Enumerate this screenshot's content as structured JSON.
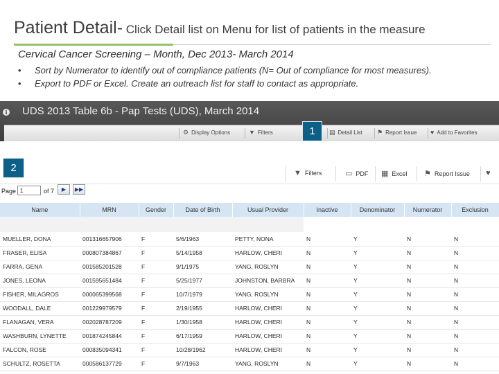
{
  "slide": {
    "title_bold": "Patient Detail-",
    "title_rest": " Click Detail list on Menu for list of patients in the measure",
    "subtitle": "Cervical Cancer Screening – Month,  Dec 2013- March 2014",
    "bullets": [
      "Sort by Numerator  to identify  out of compliance patients (N= Out of compliance for most measures).",
      "Export to PDF or Excel. Create an outreach list for staff to contact as appropriate."
    ]
  },
  "report": {
    "title": "UDS 2013 Table 6b - Pap Tests (UDS), March 2014",
    "toolbar_top": {
      "display_options": "Display Options",
      "filters": "Filters",
      "detail_list": "Detail List",
      "report_issue": "Report Issue",
      "add_to_favorites": "Add to Favorites"
    },
    "badges": {
      "one": "1",
      "two": "2"
    },
    "toolbar_second": {
      "filters": "Filters",
      "pdf": "PDF",
      "excel": "Excel",
      "report_issue": "Report Issue"
    },
    "pager": {
      "label": "Page",
      "current": "1",
      "of": "of 7"
    }
  },
  "table": {
    "columns": [
      "Name",
      "MRN",
      "Gender",
      "Date of Birth",
      "Usual Provider",
      "Inactive",
      "Denominator",
      "Numerator",
      "Exclusion"
    ],
    "rows": [
      [
        "MUELLER, DONA",
        "001316657906",
        "F",
        "5/6/1963",
        "PETTY, NONA",
        "N",
        "Y",
        "N",
        "N"
      ],
      [
        "FRASER, ELISA",
        "000807384867",
        "F",
        "5/14/1958",
        "HARLOW, CHERI",
        "N",
        "Y",
        "N",
        "N"
      ],
      [
        "FARRA, GENA",
        "001585201528",
        "F",
        "9/1/1975",
        "YANG, ROSLYN",
        "N",
        "Y",
        "N",
        "N"
      ],
      [
        "JONES, LEONA",
        "001595651484",
        "F",
        "5/25/1977",
        "JOHNSTON, BARBRA",
        "N",
        "Y",
        "N",
        "N"
      ],
      [
        "FISHER, MILAGROS",
        "000065399568",
        "F",
        "10/7/1979",
        "YANG, ROSLYN",
        "N",
        "Y",
        "N",
        "N"
      ],
      [
        "WOODALL, DALE",
        "001229979579",
        "F",
        "2/19/1955",
        "HARLOW, CHERI",
        "N",
        "Y",
        "N",
        "N"
      ],
      [
        "FLANAGAN, VERA",
        "002028787209",
        "F",
        "1/30/1958",
        "HARLOW, CHERI",
        "N",
        "Y",
        "N",
        "N"
      ],
      [
        "WASHBURN, LYNETTE",
        "001874245844",
        "F",
        "6/17/1959",
        "HARLOW, CHERI",
        "N",
        "Y",
        "N",
        "N"
      ],
      [
        "FALCON, ROSE",
        "000835094341",
        "F",
        "10/28/1962",
        "HARLOW, CHERI",
        "N",
        "Y",
        "N",
        "N"
      ],
      [
        "SCHULTZ, ROSETTA",
        "000586137729",
        "F",
        "9/7/1963",
        "YANG, ROSLYN",
        "N",
        "Y",
        "N",
        "N"
      ]
    ]
  }
}
